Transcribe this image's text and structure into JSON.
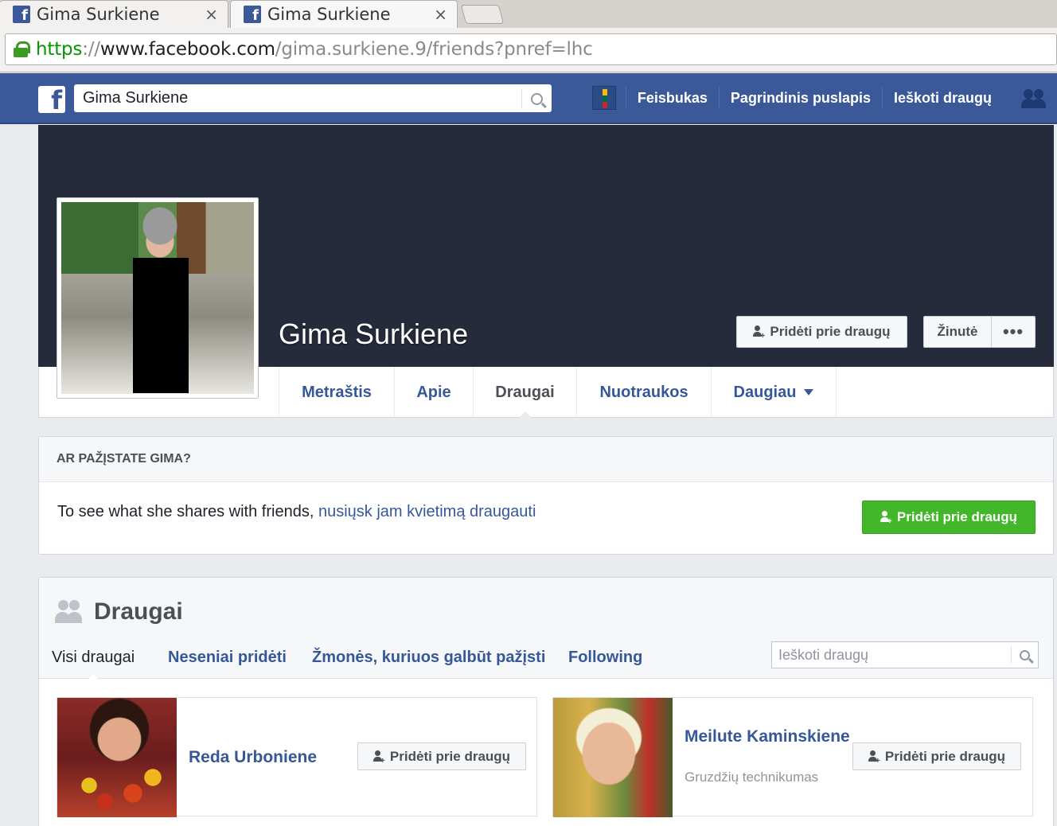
{
  "browser": {
    "tabs": [
      {
        "title": "Gima Surkiene"
      },
      {
        "title": "Gima Surkiene"
      }
    ],
    "close_glyph": "×",
    "url": {
      "scheme": "https",
      "separator": "://",
      "host": "www.facebook.com",
      "path": "/gima.surkiene.9/friends?pnref=lhc"
    }
  },
  "topbar": {
    "search_value": "Gima Surkiene",
    "nav": [
      "Feisbukas",
      "Pagrindinis puslapis",
      "Ieškoti draugų"
    ]
  },
  "profile": {
    "name": "Gima Surkiene",
    "add_friend_label": "Pridėti prie draugų",
    "message_label": "Žinutė",
    "more_label": "•••",
    "tabs": [
      "Metraštis",
      "Apie",
      "Draugai",
      "Nuotraukos",
      "Daugiau"
    ],
    "active_tab": "Draugai"
  },
  "know_card": {
    "heading": "AR PAŽĮSTATE GIMA?",
    "text": "To see what she shares with friends, ",
    "link": "nusiųsk jam kvietimą draugauti",
    "button_label": "Pridėti prie draugų"
  },
  "friends": {
    "title": "Draugai",
    "tabs": [
      "Visi draugai",
      "Neseniai pridėti",
      "Žmonės, kuriuos galbūt pažįsti",
      "Following"
    ],
    "active_tab": "Visi draugai",
    "search_placeholder": "Ieškoti draugų",
    "list": [
      {
        "name": "Reda Urboniene",
        "subtitle": "",
        "button_label": "Pridėti prie draugų"
      },
      {
        "name": "Meilute Kaminskiene",
        "subtitle": "Gruzdžių technikumas",
        "button_label": "Pridėti prie draugų"
      }
    ]
  },
  "colors": {
    "facebook_blue": "#3b5998",
    "cover_dark": "#262b3b",
    "link_blue": "#365899",
    "green_button": "#42b72a"
  },
  "icons": [
    "facebook-favicon-icon",
    "lock-icon",
    "facebook-logo-icon",
    "search-icon",
    "friend-requests-icon",
    "add-friend-icon",
    "friends-icon",
    "dropdown-caret-icon"
  ]
}
